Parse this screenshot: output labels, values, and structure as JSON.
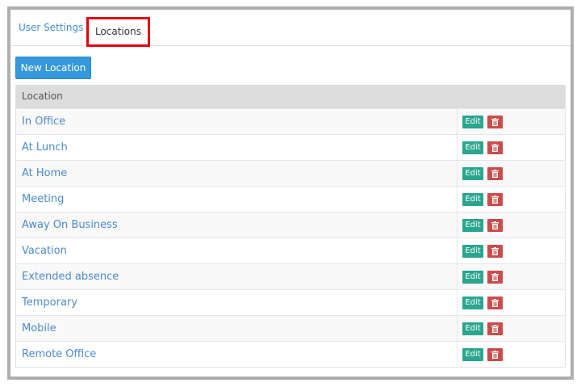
{
  "tabs": [
    {
      "label": "User Settings",
      "active": false
    },
    {
      "label": "Locations",
      "active": true
    }
  ],
  "toolbar": {
    "new_location_label": "New Location"
  },
  "table": {
    "header": "Location",
    "edit_label": "Edit",
    "rows": [
      {
        "name": "In Office"
      },
      {
        "name": "At Lunch"
      },
      {
        "name": "At Home"
      },
      {
        "name": "Meeting"
      },
      {
        "name": "Away On Business"
      },
      {
        "name": "Vacation"
      },
      {
        "name": "Extended absence"
      },
      {
        "name": "Temporary"
      },
      {
        "name": "Mobile"
      },
      {
        "name": "Remote Office"
      }
    ]
  },
  "colors": {
    "primary_button": "#3598dc",
    "edit_button": "#2aa58e",
    "delete_button": "#cc4b4b",
    "link": "#4a8ad0",
    "highlight_border": "#e3000f"
  },
  "icons": {
    "delete": "trash-icon"
  }
}
